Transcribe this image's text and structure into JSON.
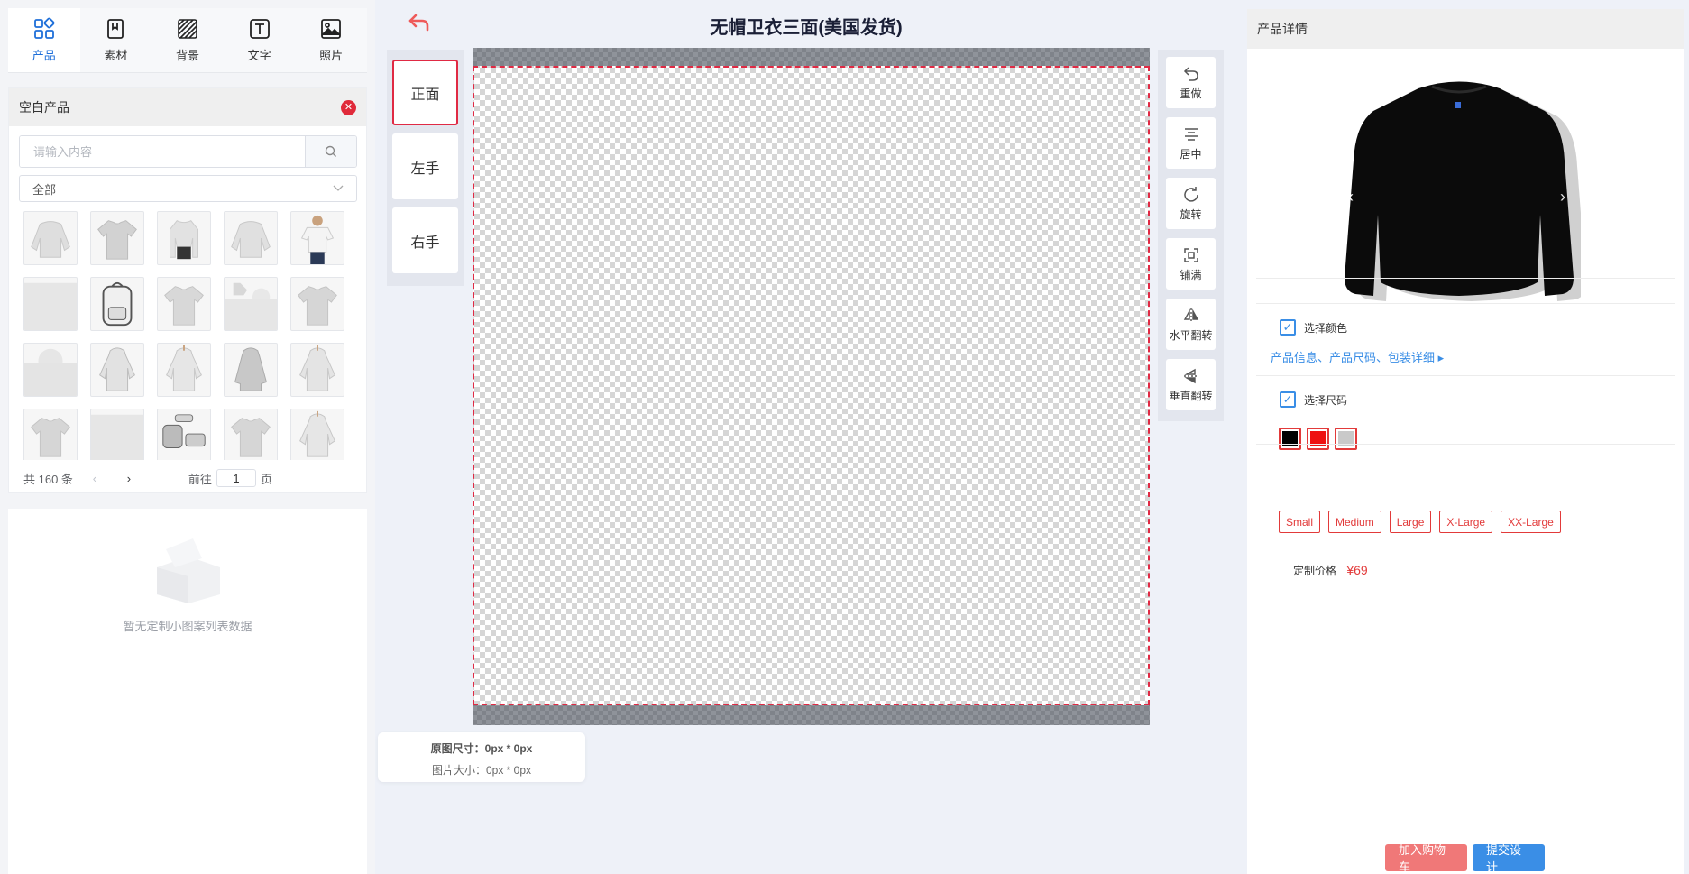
{
  "tabs": [
    {
      "label": "产品",
      "icon": "grid-icon",
      "active": true
    },
    {
      "label": "素材",
      "icon": "bookmark-icon"
    },
    {
      "label": "背景",
      "icon": "pattern-icon"
    },
    {
      "label": "文字",
      "icon": "text-icon"
    },
    {
      "label": "照片",
      "icon": "image-icon"
    }
  ],
  "blank_products": {
    "title": "空白产品",
    "search_placeholder": "请输入内容",
    "category": "全部",
    "pager": {
      "total": "共 160 条",
      "prev": "‹",
      "next": "›",
      "goto": "前往",
      "page": "1",
      "page_suffix": "页"
    }
  },
  "empty_list": {
    "text": "暂无定制小图案列表数据"
  },
  "editor": {
    "title": "无帽卫衣三面(美国发货)",
    "sides": [
      "正面",
      "左手",
      "右手"
    ],
    "tools": [
      {
        "label": "重做",
        "icon": "redo-icon"
      },
      {
        "label": "居中",
        "icon": "align-center-icon"
      },
      {
        "label": "旋转",
        "icon": "rotate-icon"
      },
      {
        "label": "铺满",
        "icon": "fill-icon"
      },
      {
        "label": "水平翻转",
        "icon": "flip-horizontal-icon"
      },
      {
        "label": "垂直翻转",
        "icon": "flip-vertical-icon"
      }
    ],
    "original_size": "原图尺寸：0px * 0px",
    "image_size": "图片大小：0px * 0px"
  },
  "detail": {
    "title": "产品详情",
    "info_link": "产品信息、产品尺码、包装详细",
    "color_label": "选择颜色",
    "colors": [
      "#000000",
      "#ee1111",
      "#c9c9c9"
    ],
    "size_label": "选择尺码",
    "sizes": [
      "Small",
      "Medium",
      "Large",
      "X-Large",
      "XX-Large"
    ],
    "price_label": "定制价格",
    "price": "¥69",
    "add_cart": "加入购物车",
    "submit": "提交设计"
  }
}
